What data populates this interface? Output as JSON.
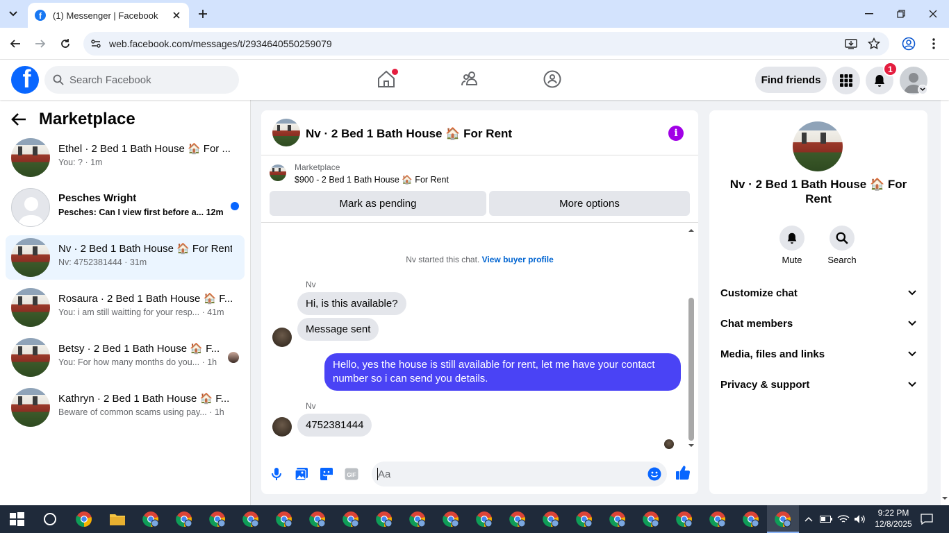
{
  "browser": {
    "tab_title": "(1) Messenger | Facebook",
    "url": "web.facebook.com/messages/t/2934640550259079"
  },
  "fb_header": {
    "search_placeholder": "Search Facebook",
    "find_friends": "Find friends",
    "notification_count": "1"
  },
  "left_panel": {
    "title": "Marketplace",
    "conversations": [
      {
        "name": "Ethel · 2 Bed 1 Bath House 🏠 For ...",
        "preview": "You: ? · 1m",
        "unread": false,
        "active": false
      },
      {
        "name": "Pesches Wright",
        "preview": "Pesches: Can I view first before a...  12m",
        "unread": true,
        "active": false
      },
      {
        "name": "Nv · 2 Bed 1 Bath House 🏠 For Rent",
        "preview": "Nv: 4752381444 · 31m",
        "unread": false,
        "active": true
      },
      {
        "name": "Rosaura · 2 Bed 1 Bath House 🏠 F...",
        "preview": "You: i am still waitting for your resp... · 41m",
        "unread": false,
        "active": false
      },
      {
        "name": "Betsy · 2 Bed 1 Bath House 🏠 F...",
        "preview": "You: For how many months do you... · 1h",
        "unread": false,
        "active": false
      },
      {
        "name": "Kathryn · 2 Bed 1 Bath House 🏠 F...",
        "preview": "Beware of common scams using pay... · 1h",
        "unread": false,
        "active": false
      }
    ]
  },
  "chat": {
    "title": "Nv · 2 Bed 1 Bath House 🏠 For Rent",
    "marketplace_label": "Marketplace",
    "listing": "$900 - 2 Bed 1 Bath House 🏠 For Rent",
    "mark_pending": "Mark as pending",
    "more_options": "More options",
    "started_text": "Nv started this chat.",
    "view_buyer_profile": "View buyer profile",
    "sender": "Nv",
    "messages": [
      {
        "text": "Hi, is this available?"
      },
      {
        "text": "Message sent"
      },
      {
        "text": "Hello, yes the house is still available for rent, let me have your contact number so i can send you  details."
      },
      {
        "text": "4752381444"
      }
    ],
    "composer_placeholder": "Aa"
  },
  "right_panel": {
    "title": "Nv · 2 Bed 1 Bath House 🏠 For Rent",
    "mute": "Mute",
    "search": "Search",
    "sections": [
      "Customize chat",
      "Chat members",
      "Media, files and links",
      "Privacy & support"
    ]
  },
  "taskbar": {
    "time": "9:22 PM",
    "date": "12/8/2025"
  },
  "colors": {
    "fb_blue": "#0866ff",
    "outgoing_bubble": "#4a43f5",
    "info_purple": "#a100e6",
    "notification_red": "#e41e3f",
    "active_row": "#ebf5ff"
  }
}
